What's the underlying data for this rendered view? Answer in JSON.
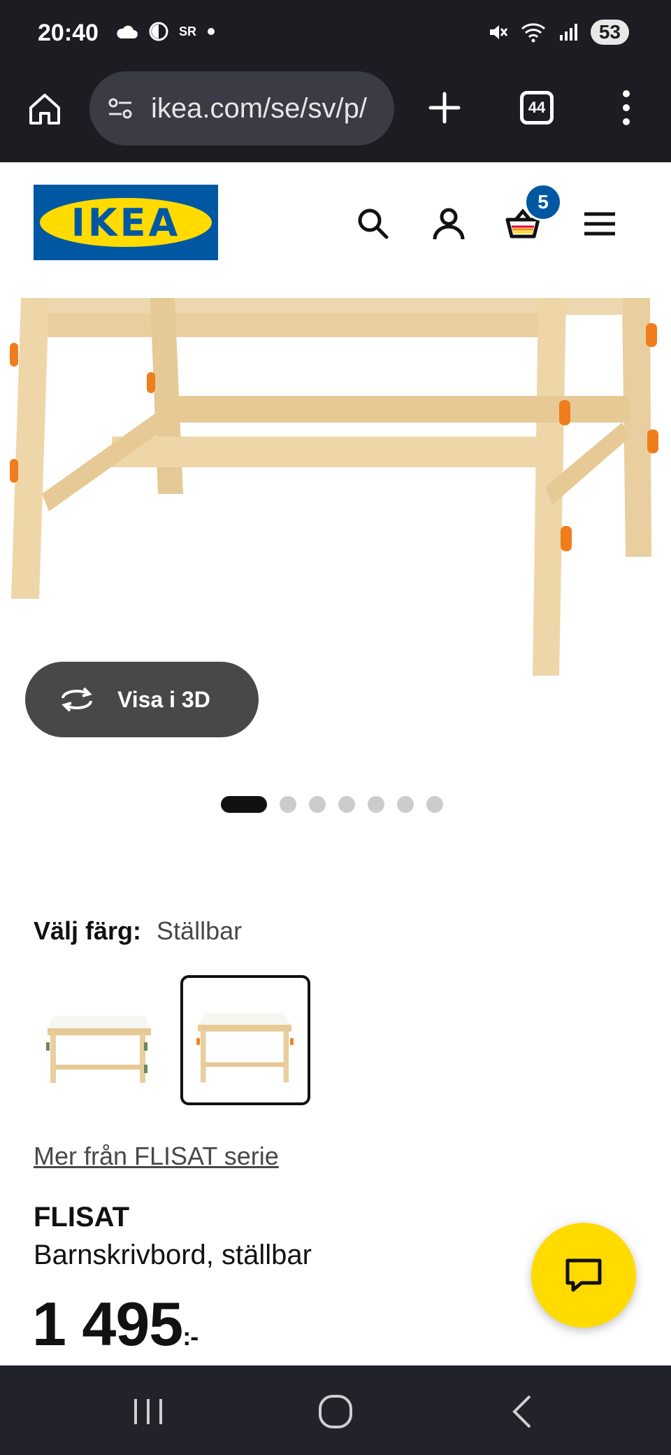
{
  "status_bar": {
    "time": "20:40",
    "left_icons": [
      "cloud-icon",
      "do-not-disturb-icon",
      "sr-icon",
      "dot-icon"
    ],
    "sr_label": "SR",
    "battery": "53"
  },
  "browser": {
    "url": "ikea.com/se/sv/p/",
    "tab_count": "44"
  },
  "header": {
    "logo_text": "IKEA",
    "cart_count": "5"
  },
  "product": {
    "view_3d_label": "Visa i 3D",
    "carousel": {
      "total": 7,
      "active_index": 0
    },
    "color_label": "Välj färg:",
    "color_value": "Ställbar",
    "swatches": [
      {
        "name": "color-swatch-1",
        "selected": false
      },
      {
        "name": "color-swatch-2",
        "selected": true
      }
    ],
    "series_link": "Mer från FLISAT serie",
    "name": "FLISAT",
    "description": "Barnskrivbord, ställbar",
    "price": "1 495",
    "price_suffix": ":-"
  },
  "colors": {
    "ikea_blue": "#0058a3",
    "ikea_yellow": "#ffdb00",
    "chrome_dark": "#1c1c22",
    "button_gray": "#484848"
  }
}
